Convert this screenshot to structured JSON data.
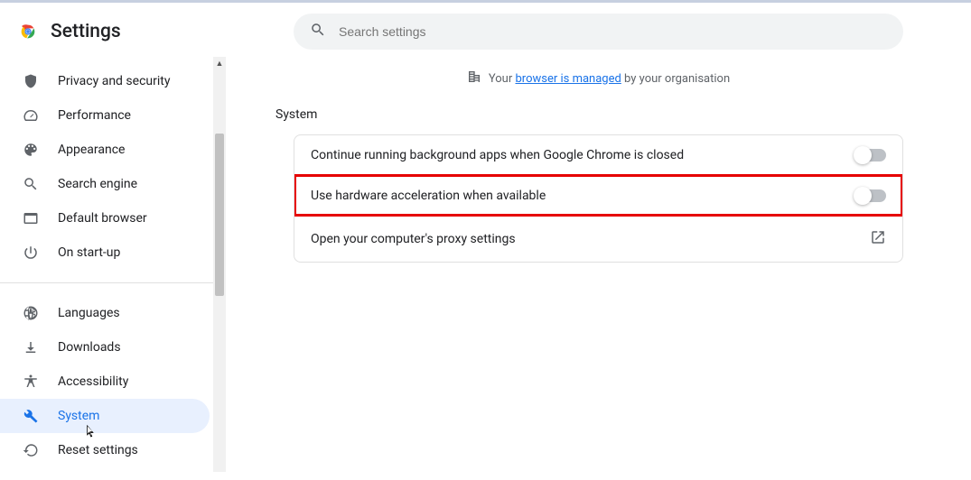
{
  "header": {
    "title": "Settings"
  },
  "search": {
    "placeholder": "Search settings"
  },
  "managed": {
    "prefix": "Your ",
    "link": "browser is managed",
    "suffix": " by your organisation"
  },
  "section": {
    "title": "System"
  },
  "rows": {
    "background": "Continue running background apps when Google Chrome is closed",
    "hwaccel": "Use hardware acceleration when available",
    "proxy": "Open your computer's proxy settings"
  },
  "nav": {
    "privacy": "Privacy and security",
    "performance": "Performance",
    "appearance": "Appearance",
    "search_engine": "Search engine",
    "default_browser": "Default browser",
    "on_startup": "On start-up",
    "languages": "Languages",
    "downloads": "Downloads",
    "accessibility": "Accessibility",
    "system": "System",
    "reset": "Reset settings"
  }
}
